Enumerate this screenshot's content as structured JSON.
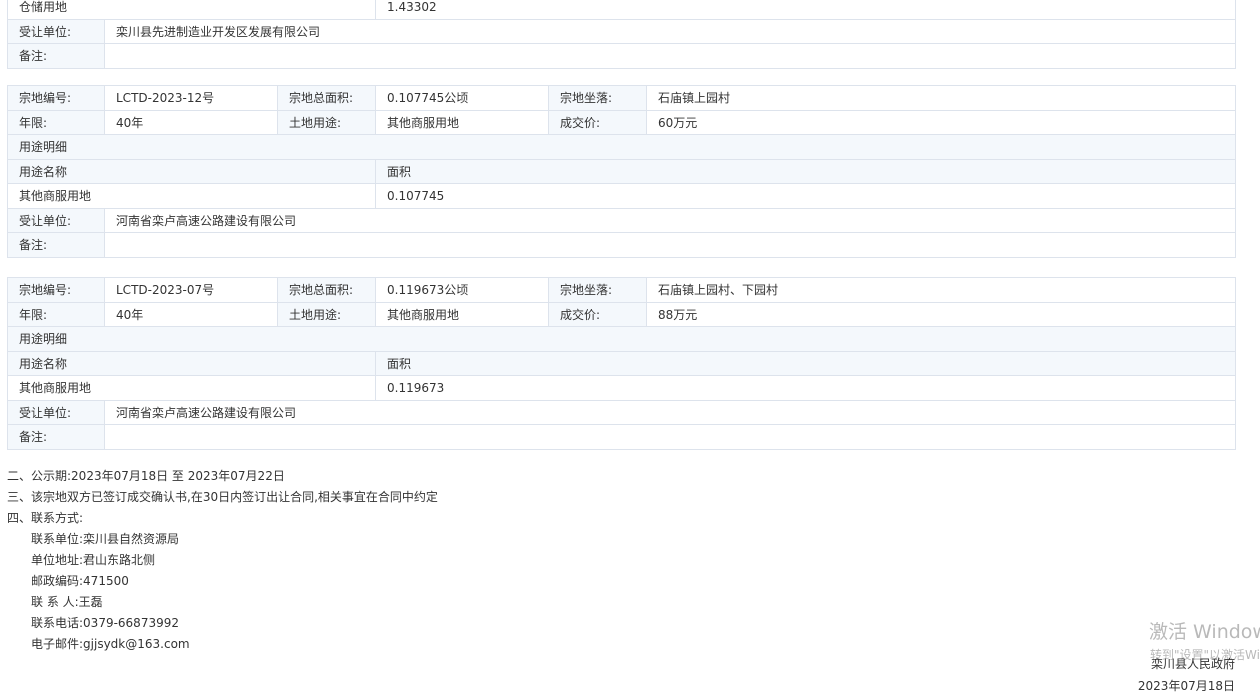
{
  "block0": {
    "storage_row": {
      "name": "仓储用地",
      "area": "1.43302"
    },
    "assignee_label": "受让单位:",
    "assignee": "栾川县先进制造业开发区发展有限公司",
    "remark_label": "备注:",
    "remark": ""
  },
  "parcel1": {
    "l_id": "宗地编号:",
    "id": "LCTD-2023-12号",
    "l_area": "宗地总面积:",
    "area": "0.107745公顷",
    "l_loc": "宗地坐落:",
    "loc": "石庙镇上园村",
    "l_term": "年限:",
    "term": "40年",
    "l_use": "土地用途:",
    "use": "其他商服用地",
    "l_price": "成交价:",
    "price": "60万元",
    "usage_title": "用途明细",
    "h_name": "用途名称",
    "h_area": "面积",
    "use_name": "其他商服用地",
    "use_area": "0.107745",
    "l_assignee": "受让单位:",
    "assignee": "河南省栾卢高速公路建设有限公司",
    "l_remark": "备注:",
    "remark": ""
  },
  "parcel2": {
    "l_id": "宗地编号:",
    "id": "LCTD-2023-07号",
    "l_area": "宗地总面积:",
    "area": "0.119673公顷",
    "l_loc": "宗地坐落:",
    "loc": "石庙镇上园村、下园村",
    "l_term": "年限:",
    "term": "40年",
    "l_use": "土地用途:",
    "use": "其他商服用地",
    "l_price": "成交价:",
    "price": "88万元",
    "usage_title": "用途明细",
    "h_name": "用途名称",
    "h_area": "面积",
    "use_name": "其他商服用地",
    "use_area": "0.119673",
    "l_assignee": "受让单位:",
    "assignee": "河南省栾卢高速公路建设有限公司",
    "l_remark": "备注:",
    "remark": ""
  },
  "notes": {
    "publicity": "二、公示期:2023年07月18日 至 2023年07月22日",
    "contract": "三、该宗地双方已签订成交确认书,在30日内签订出让合同,相关事宜在合同中约定",
    "contact_title": "四、联系方式:",
    "unit": "联系单位:栾川县自然资源局",
    "address": "单位地址:君山东路北侧",
    "postcode": "邮政编码:471500",
    "person": "联 系 人:王磊",
    "phone": "联系电话:0379-66873992",
    "email": "电子邮件:gjjsydk@163.com"
  },
  "signature": {
    "org": "栾川县人民政府",
    "date": "2023年07月18日"
  },
  "watermark": {
    "line1": "激活 Windows",
    "line2": "转到\"设置\"以激活Windows。"
  }
}
